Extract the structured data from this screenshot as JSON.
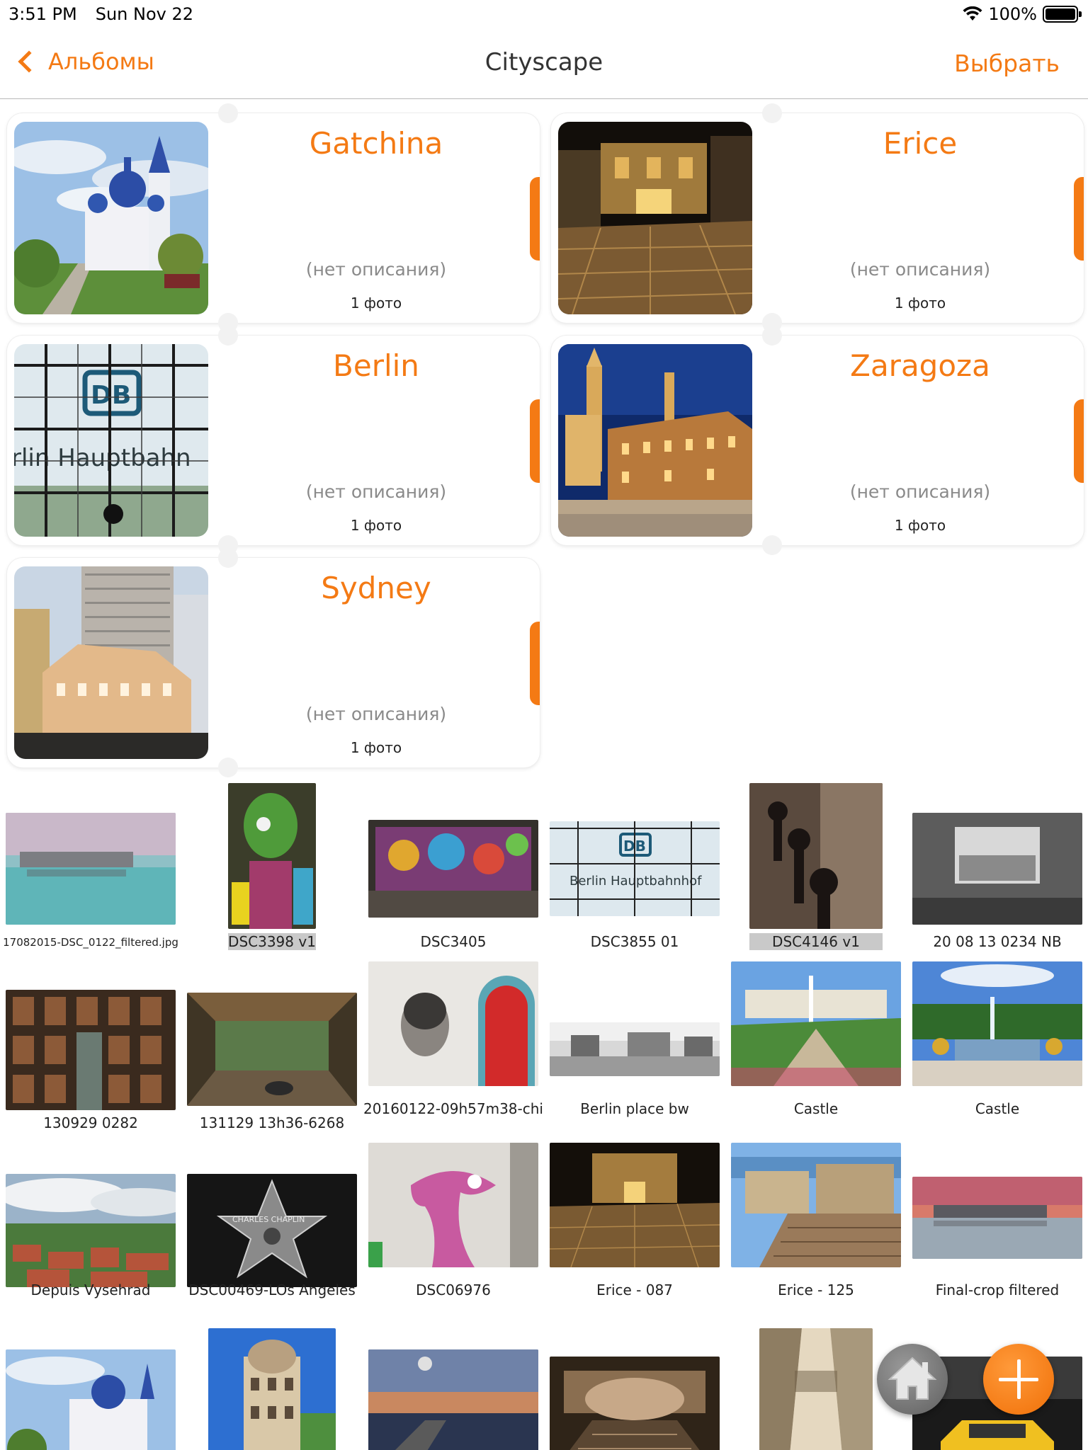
{
  "status_bar": {
    "time": "3:51 PM",
    "date": "Sun Nov 22",
    "battery": "100%"
  },
  "nav": {
    "back_label": "Альбомы",
    "title": "Cityscape",
    "select_label": "Выбрать"
  },
  "albums": [
    {
      "title": "Gatchina",
      "description": "(нет описания)",
      "count": "1 фото"
    },
    {
      "title": "Erice",
      "description": "(нет описания)",
      "count": "1 фото"
    },
    {
      "title": "Berlin",
      "description": "(нет описания)",
      "count": "1 фото"
    },
    {
      "title": "Zaragoza",
      "description": "(нет описания)",
      "count": "1 фото"
    },
    {
      "title": "Sydney",
      "description": "(нет описания)",
      "count": "1 фото"
    }
  ],
  "photos": [
    {
      "caption": "17082015-DSC_0122_filtered.jpg"
    },
    {
      "caption": "DSC3398 v1"
    },
    {
      "caption": "DSC3405"
    },
    {
      "caption": "DSC3855 01"
    },
    {
      "caption": "DSC4146 v1"
    },
    {
      "caption": "20 08 13 0234 NB"
    },
    {
      "caption": "130929 0282"
    },
    {
      "caption": "131129 13h36-6268"
    },
    {
      "caption": "20160122-09h57m38-chi"
    },
    {
      "caption": "Berlin place bw"
    },
    {
      "caption": "Castle"
    },
    {
      "caption": "Castle"
    },
    {
      "caption": "Depuis Vysehrad"
    },
    {
      "caption": "DSC00469-LOs Angeles"
    },
    {
      "caption": "DSC06976"
    },
    {
      "caption": "Erice - 087"
    },
    {
      "caption": "Erice - 125"
    },
    {
      "caption": "Final-crop filtered"
    }
  ],
  "fabs": {
    "home_icon": "home-icon",
    "add_icon": "plus-icon"
  },
  "colors": {
    "accent": "#f47a14"
  }
}
